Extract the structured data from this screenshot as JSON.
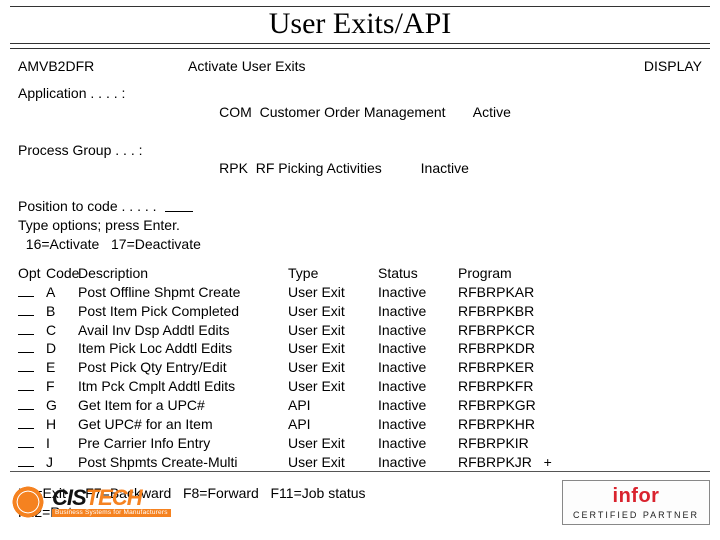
{
  "title": "User Exits/API",
  "header": {
    "program_id": "AMVB2DFR",
    "screen_title": "Activate User Exits",
    "mode": "DISPLAY"
  },
  "meta": {
    "application_label": "Application . . . . :",
    "application_code": "COM",
    "application_desc": "Customer Order Management",
    "application_status": "Active",
    "process_group_label": "Process Group . . . :",
    "process_group_code": "RPK",
    "process_group_desc": "RF Picking Activities",
    "process_group_status": "Inactive",
    "position_label": "Position to code . . . . .",
    "instr1": "Type options; press Enter.",
    "instr2": "  16=Activate   17=Deactivate"
  },
  "columns": {
    "opt": "Opt",
    "code": "Code",
    "desc": "Description",
    "type": "Type",
    "status": "Status",
    "program": "Program"
  },
  "rows": [
    {
      "code": "A",
      "desc": "Post Offline Shpmt Create",
      "type": "User Exit",
      "status": "Inactive",
      "program": "RFBRPKAR"
    },
    {
      "code": "B",
      "desc": "Post Item Pick Completed",
      "type": "User Exit",
      "status": "Inactive",
      "program": "RFBRPKBR"
    },
    {
      "code": "C",
      "desc": "Avail Inv Dsp Addtl Edits",
      "type": "User Exit",
      "status": "Inactive",
      "program": "RFBRPKCR"
    },
    {
      "code": "D",
      "desc": "Item Pick Loc Addtl Edits",
      "type": "User Exit",
      "status": "Inactive",
      "program": "RFBRPKDR"
    },
    {
      "code": "E",
      "desc": "Post Pick Qty Entry/Edit",
      "type": "User Exit",
      "status": "Inactive",
      "program": "RFBRPKER"
    },
    {
      "code": "F",
      "desc": "Itm Pck Cmplt Addtl Edits",
      "type": "User Exit",
      "status": "Inactive",
      "program": "RFBRPKFR"
    },
    {
      "code": "G",
      "desc": "Get Item for a UPC#",
      "type": "API",
      "status": "Inactive",
      "program": "RFBRPKGR"
    },
    {
      "code": "H",
      "desc": "Get UPC# for an Item",
      "type": "API",
      "status": "Inactive",
      "program": "RFBRPKHR"
    },
    {
      "code": "I",
      "desc": "Pre Carrier Info Entry",
      "type": "User Exit",
      "status": "Inactive",
      "program": "RFBRPKIR"
    },
    {
      "code": "J",
      "desc": "Post Shpmts Create-Multi",
      "type": "User Exit",
      "status": "Inactive",
      "program": "RFBRPKJR"
    }
  ],
  "more_indicator": "+",
  "fkeys": {
    "line1": "F3=Exit     F7=Backward   F8=Forward   F11=Job status",
    "line2": "F12=Return"
  },
  "logos": {
    "cistech_name_left": "CIS",
    "cistech_name_right": "TECH",
    "cistech_tag": "Business Systems for Manufacturers",
    "infor_name": "infor",
    "infor_sub": "CERTIFIED PARTNER"
  }
}
